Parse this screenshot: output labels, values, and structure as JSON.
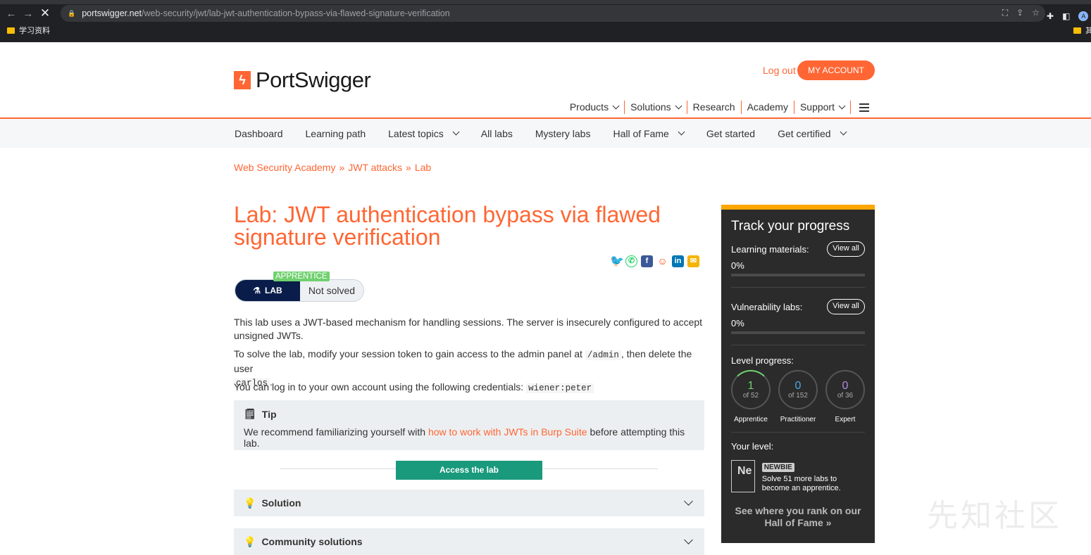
{
  "browser": {
    "url_domain": "portswigger.net",
    "url_path": "/web-security/jwt/lab-jwt-authentication-bypass-via-flawed-signature-verification",
    "bookmark_folder": "学习资料",
    "bookmark_right": "其",
    "avatar_letter": "A"
  },
  "header": {
    "brand": "PortSwigger",
    "logout_label": "Log out",
    "account_label": "MY ACCOUNT",
    "nav": [
      "Products",
      "Solutions",
      "Research",
      "Academy",
      "Support"
    ]
  },
  "subnav": [
    "Dashboard",
    "Learning path",
    "Latest topics",
    "All labs",
    "Mystery labs",
    "Hall of Fame",
    "Get started",
    "Get certified"
  ],
  "breadcrumb": [
    "Web Security Academy",
    "JWT attacks",
    "Lab"
  ],
  "breadcrumb_sep": "»",
  "lab": {
    "title": "Lab: JWT authentication bypass via flawed signature verification",
    "level_badge": "APPRENTICE",
    "lab_label": "LAB",
    "status": "Not solved",
    "p1": "This lab uses a JWT-based mechanism for handling sessions. The server is insecurely configured to accept unsigned JWTs.",
    "p2_a": "To solve the lab, modify your session token to gain access to the admin panel at ",
    "p2_code1": "/admin",
    "p2_b": ", then delete the user ",
    "p2_code2": "carlos",
    "p2_c": ".",
    "p3_a": "You can log in to your own account using the following credentials: ",
    "p3_code": "wiener:peter",
    "tip_title": "Tip",
    "tip_a": "We recommend familiarizing yourself with ",
    "tip_link": "how to work with JWTs in Burp Suite",
    "tip_b": " before attempting this lab.",
    "access_label": "Access the lab",
    "solution_label": "Solution",
    "community_label": "Community solutions"
  },
  "progress": {
    "title": "Track your progress",
    "learning_label": "Learning materials:",
    "learning_pct": "0%",
    "vuln_label": "Vulnerability labs:",
    "vuln_pct": "0%",
    "view_all": "View all",
    "level_label": "Level progress:",
    "levels": [
      {
        "n": "1",
        "of": "of 52",
        "name": "Apprentice",
        "color": "#70d16e"
      },
      {
        "n": "0",
        "of": "of 152",
        "name": "Practitioner",
        "color": "#4aa8e0"
      },
      {
        "n": "0",
        "of": "of 36",
        "name": "Expert",
        "color": "#b08ad8"
      }
    ],
    "your_level_label": "Your level:",
    "element_symbol": "Ne",
    "level_name": "NEWBIE",
    "level_text": "Solve 51 more labs to become an apprentice.",
    "rank_text": "See where you rank on our Hall of Fame »"
  },
  "watermark": "先知社区",
  "colors": {
    "accent": "#ff6633",
    "progress_border": "#ffa600",
    "access_btn": "#1a9a7c",
    "lab_pill": "#0a1d4a"
  }
}
